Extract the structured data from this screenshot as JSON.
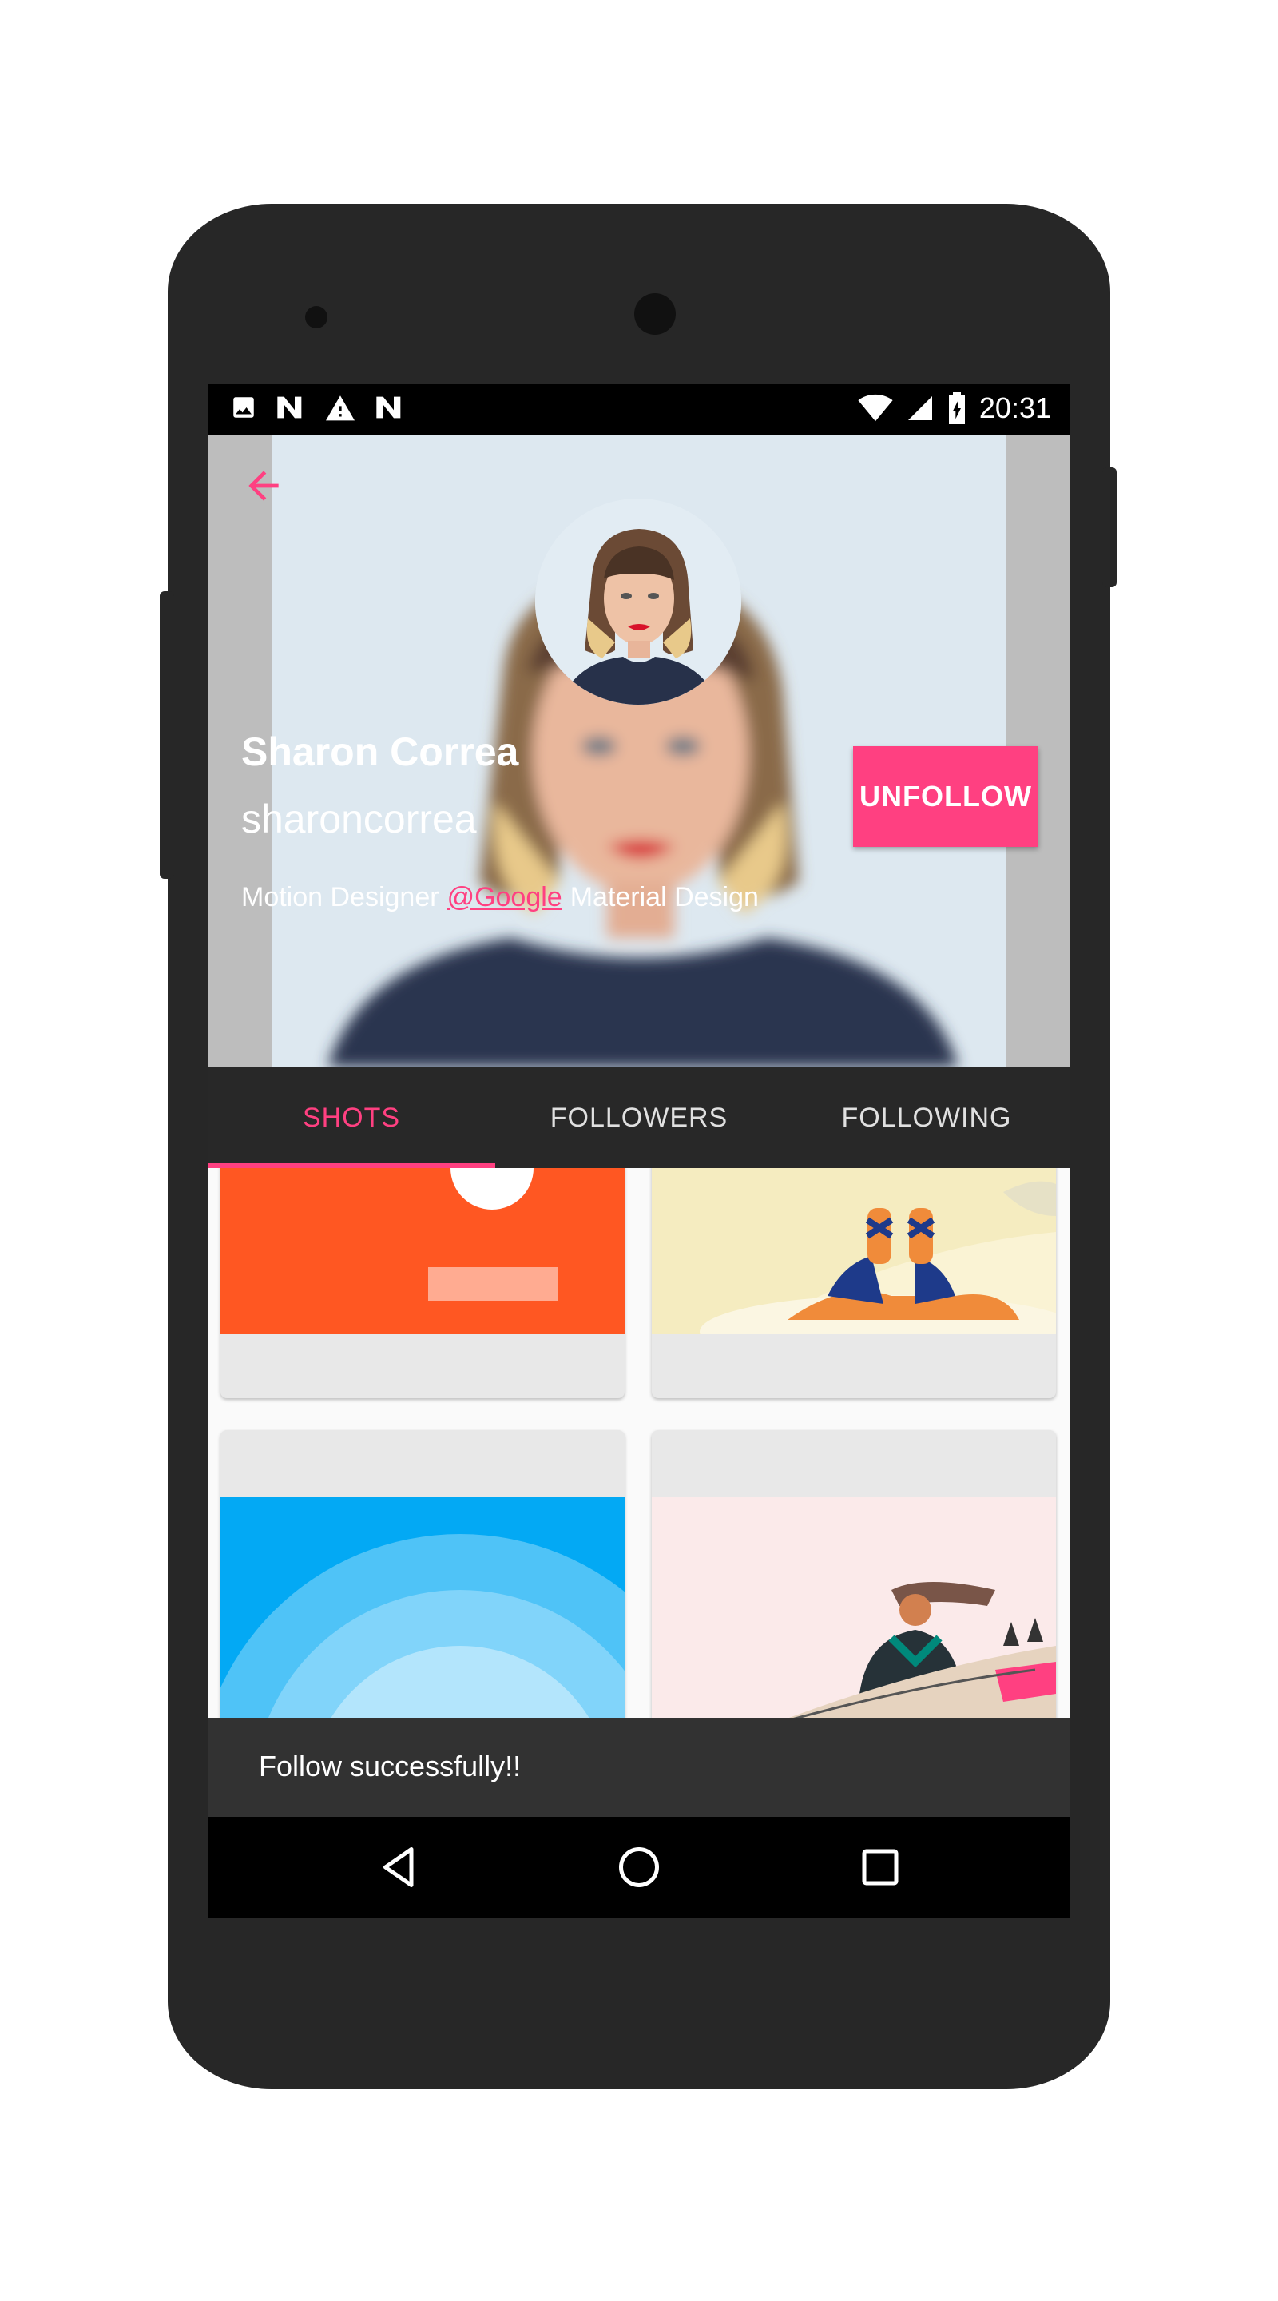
{
  "status_bar": {
    "left_icons": [
      "image-icon",
      "n-icon",
      "warning-icon",
      "n-icon"
    ],
    "right_icons": [
      "wifi-icon",
      "signal-icon",
      "battery-charging-icon"
    ],
    "time": "20:31"
  },
  "profile": {
    "back_icon": "arrow-back-icon",
    "name": "Sharon Correa",
    "username": "sharoncorrea",
    "bio_prefix": "Motion Designer",
    "bio_link": "@Google",
    "bio_suffix": "Material Design",
    "unfollow_label": "UNFOLLOW"
  },
  "tabs": [
    {
      "label": "SHOTS",
      "active": true
    },
    {
      "label": "FOLLOWERS",
      "active": false
    },
    {
      "label": "FOLLOWING",
      "active": false
    }
  ],
  "shots": [
    {
      "name": "orange-shot",
      "color": "#ff5722"
    },
    {
      "name": "sandals-shot",
      "color": "#faf3d4"
    },
    {
      "name": "blue-circles-shot",
      "color": "#03a9f4"
    },
    {
      "name": "surfer-shot",
      "color": "#fbeaea"
    }
  ],
  "snackbar": {
    "message": "Follow successfully!!"
  },
  "nav_bar": {
    "buttons": [
      "back-nav-icon",
      "home-nav-icon",
      "recents-nav-icon"
    ]
  },
  "colors": {
    "accent": "#ff4081",
    "tabs_bg": "#282828",
    "snackbar_bg": "#323232"
  }
}
